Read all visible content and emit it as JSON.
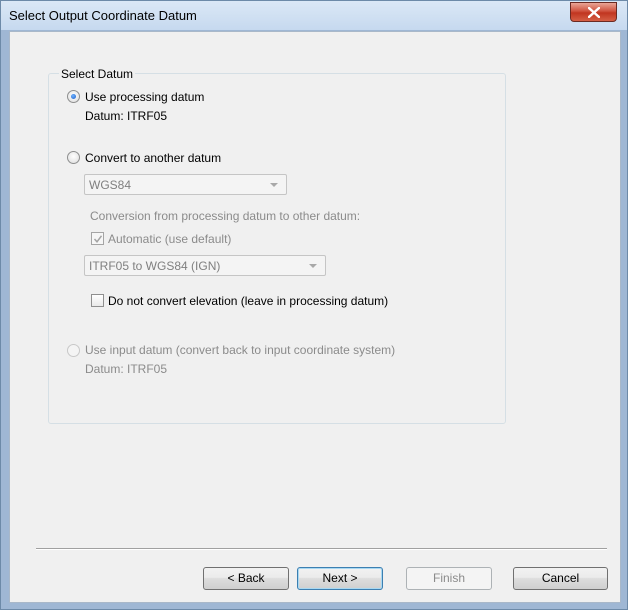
{
  "window": {
    "title": "Select Output Coordinate Datum"
  },
  "group": {
    "legend": "Select Datum"
  },
  "option_processing": {
    "label": "Use processing datum",
    "detail": "Datum: ITRF05",
    "checked": true
  },
  "option_convert": {
    "label": "Convert to another datum",
    "checked": false,
    "datum_select": "WGS84",
    "conversion_text": "Conversion from processing datum to other datum:",
    "automatic_label": "Automatic (use default)",
    "automatic_checked": true,
    "transform_select": "ITRF05 to WGS84 (IGN)",
    "elevation_label": "Do not convert elevation (leave in processing datum)",
    "elevation_checked": false
  },
  "option_input": {
    "label": "Use input datum (convert back to input coordinate system)",
    "detail": "Datum: ITRF05",
    "checked": false
  },
  "buttons": {
    "back": "< Back",
    "next": "Next >",
    "finish": "Finish",
    "cancel": "Cancel"
  },
  "colors": {
    "frame": "#9fb7d4",
    "close_button": "#c13520",
    "dialog_bg": "#f0f0f0",
    "disabled_text": "#8b8b8b",
    "default_button_border": "#3c7fb1"
  },
  "icons": {
    "close": "close-icon",
    "dropdown": "chevron-down-icon",
    "check": "check-icon"
  }
}
